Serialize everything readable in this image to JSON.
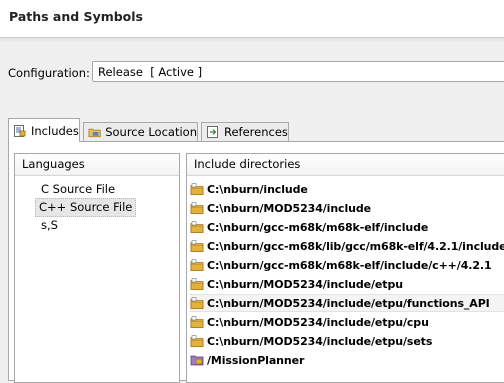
{
  "page": {
    "title": "Paths and Symbols"
  },
  "configuration": {
    "label": "Configuration:",
    "value": "Release  [ Active ]"
  },
  "tabs": [
    {
      "label": "Includes",
      "icon": "includes-icon",
      "active": true
    },
    {
      "label": "Source Location",
      "icon": "source-folder-icon",
      "active": false
    },
    {
      "label": "References",
      "icon": "references-icon",
      "active": false
    }
  ],
  "languages": {
    "header": "Languages",
    "items": [
      "C Source File",
      "C++ Source File",
      "s,S"
    ],
    "selected": "C++ Source File"
  },
  "include_directories": {
    "header": "Include directories",
    "items": [
      {
        "path": "C:\\nburn/include",
        "icon": "include-folder-icon"
      },
      {
        "path": "C:\\nburn/MOD5234/include",
        "icon": "include-folder-icon"
      },
      {
        "path": "C:\\nburn/gcc-m68k/m68k-elf/include",
        "icon": "include-folder-icon"
      },
      {
        "path": "C:\\nburn/gcc-m68k/lib/gcc/m68k-elf/4.2.1/include",
        "icon": "include-folder-icon"
      },
      {
        "path": "C:\\nburn/gcc-m68k/m68k-elf/include/c++/4.2.1",
        "icon": "include-folder-icon"
      },
      {
        "path": "C:\\nburn/MOD5234/include/etpu",
        "icon": "include-folder-icon"
      },
      {
        "path": "C:\\nburn/MOD5234/include/etpu/functions_API",
        "icon": "include-folder-icon"
      },
      {
        "path": "C:\\nburn/MOD5234/include/etpu/cpu",
        "icon": "include-folder-icon"
      },
      {
        "path": "C:\\nburn/MOD5234/include/etpu/sets",
        "icon": "include-folder-icon"
      },
      {
        "path": "/MissionPlanner",
        "icon": "project-folder-icon"
      }
    ]
  },
  "colors": {
    "folder": "#d9a520",
    "folder_dark": "#a8741a",
    "selection": "#e6e6e6"
  }
}
